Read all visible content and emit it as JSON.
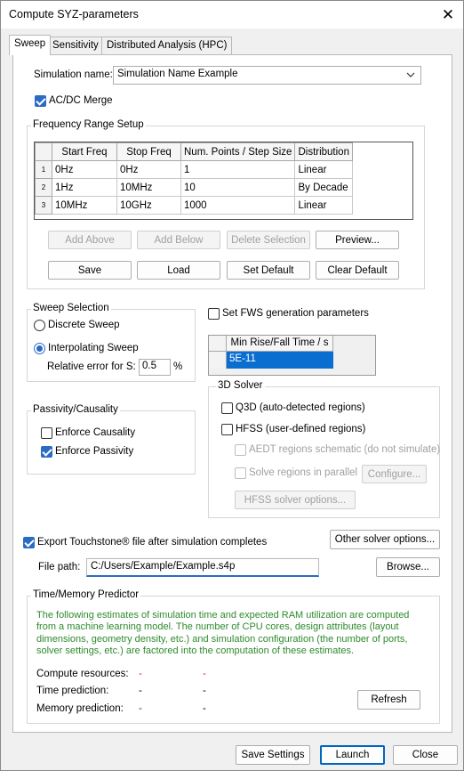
{
  "window": {
    "title": "Compute SYZ-parameters",
    "close_icon": "✕"
  },
  "tabs": [
    {
      "label": "Sweep"
    },
    {
      "label": "Sensitivity"
    },
    {
      "label": "Distributed Analysis (HPC)"
    }
  ],
  "simulation": {
    "name_label": "Simulation name:",
    "name_value": "Simulation Name Example",
    "acdc_label": "AC/DC Merge",
    "acdc_checked": true
  },
  "freq": {
    "group_title": "Frequency Range Setup",
    "columns": [
      "Start Freq",
      "Stop Freq",
      "Num. Points / Step Size",
      "Distribution"
    ],
    "rows": [
      {
        "num": "1",
        "start": "0Hz",
        "stop": "0Hz",
        "points": "1",
        "dist": "Linear"
      },
      {
        "num": "2",
        "start": "1Hz",
        "stop": "10MHz",
        "points": "10",
        "dist": "By Decade"
      },
      {
        "num": "3",
        "start": "10MHz",
        "stop": "10GHz",
        "points": "1000",
        "dist": "Linear"
      }
    ],
    "buttons": {
      "add_above": "Add Above",
      "add_below": "Add Below",
      "delete": "Delete Selection",
      "preview": "Preview...",
      "save": "Save",
      "load": "Load",
      "set_default": "Set Default",
      "clear_default": "Clear Default"
    }
  },
  "sweep": {
    "group_title": "Sweep Selection",
    "discrete": "Discrete Sweep",
    "interpolating": "Interpolating Sweep",
    "selected": "interpolating",
    "rel_error_label": "Relative error for S:",
    "rel_error_value": "0.5",
    "rel_error_unit": "%"
  },
  "fws": {
    "checkbox_label": "Set FWS generation parameters",
    "checked": false,
    "column": "Min Rise/Fall Time / s",
    "value": "5E-11"
  },
  "passivity": {
    "group_title": "Passivity/Causality",
    "causality": "Enforce Causality",
    "causality_checked": false,
    "passivity": "Enforce Passivity",
    "passivity_checked": true
  },
  "solver3d": {
    "group_title": "3D Solver",
    "q3d": "Q3D (auto-detected regions)",
    "hfss": "HFSS (user-defined regions)",
    "aedt": "AEDT regions schematic (do not simulate)",
    "parallel": "Solve regions in parallel",
    "configure": "Configure...",
    "hfss_options": "HFSS solver options..."
  },
  "export": {
    "checkbox_label": "Export Touchstone® file after simulation completes",
    "checked": true,
    "other_options": "Other solver options...",
    "file_path_label": "File path:",
    "file_path_value": "C:/Users/Example/Example.s4p",
    "browse": "Browse..."
  },
  "predictor": {
    "group_title": "Time/Memory Predictor",
    "description": "The following estimates of simulation time and expected RAM utilization are computed from a machine learning model. The number of CPU cores, design attributes (layout dimensions, geometry density, etc.) and simulation configuration (the number of ports, solver settings, etc.) are factored into the computation of these estimates.",
    "compute_label": "Compute resources:",
    "compute_val1": "-",
    "compute_val2": "-",
    "time_label": "Time prediction:",
    "time_val1": "-",
    "time_val2": "-",
    "memory_label": "Memory prediction:",
    "memory_val1": "-",
    "memory_val2": "-",
    "refresh": "Refresh"
  },
  "footer": {
    "save_settings": "Save Settings",
    "launch": "Launch",
    "close": "Close"
  }
}
